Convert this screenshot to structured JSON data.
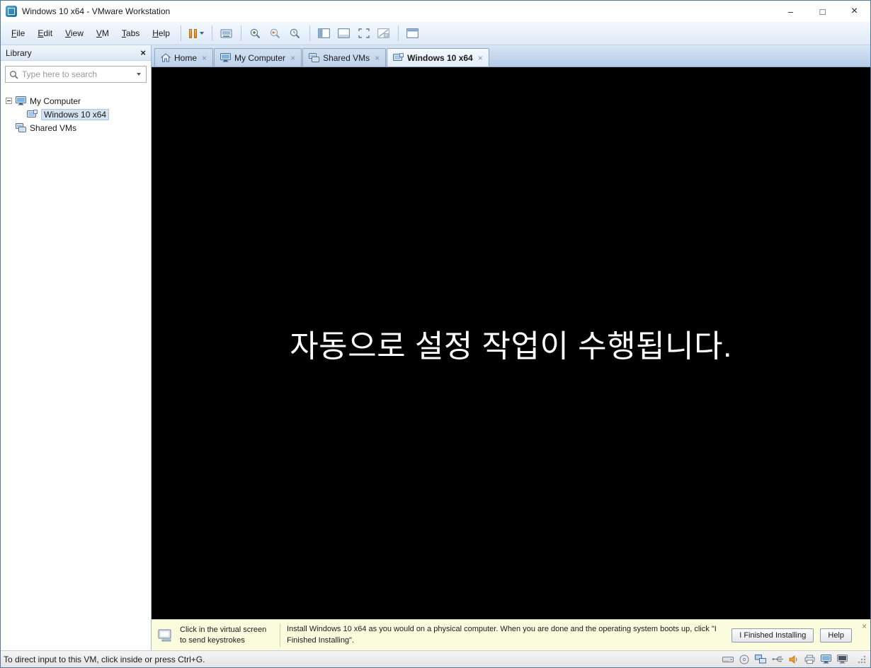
{
  "window": {
    "title": "Windows 10 x64 - VMware Workstation",
    "controls": {
      "minimize": "–",
      "maximize": "□",
      "close": "×"
    }
  },
  "glyphs": {
    "close": "×"
  },
  "menubar": {
    "items": [
      "File",
      "Edit",
      "View",
      "VM",
      "Tabs",
      "Help"
    ]
  },
  "toolbar": {
    "buttons": [
      "pause",
      "power-dropdown",
      "send-ctrl-alt-del",
      "take-snapshot",
      "revert-snapshot",
      "snapshot-manager",
      "show-library",
      "summary-view",
      "fullscreen",
      "unity-mode",
      "console-view"
    ],
    "pause_color": "#e8972e"
  },
  "library": {
    "title": "Library",
    "search_placeholder": "Type here to search",
    "tree": {
      "my_computer": "My Computer",
      "windows_vm": "Windows 10 x64",
      "shared_vms": "Shared VMs"
    }
  },
  "tabs": [
    {
      "label": "Home"
    },
    {
      "label": "My Computer"
    },
    {
      "label": "Shared VMs"
    },
    {
      "label": "Windows 10 x64",
      "active": true
    }
  ],
  "vm_screen": {
    "message": "자동으로 설정 작업이 수행됩니다.",
    "background": "#000000",
    "text_color": "#ffffff"
  },
  "notification": {
    "hint": "Click in the virtual screen to send keystrokes",
    "message": "Install Windows 10 x64 as you would on a physical computer. When you are done and the operating system boots up, click \"I Finished Installing\".",
    "finish_button": "I Finished Installing",
    "help_button": "Help",
    "background": "#fbfbdd"
  },
  "statusbar": {
    "message": "To direct input to this VM, click inside or press Ctrl+G.",
    "device_icons": [
      "hard-disk",
      "cd-dvd",
      "network-adapter",
      "usb-controller",
      "sound-card",
      "printer",
      "display",
      "console"
    ]
  },
  "colors": {
    "tabbar_blue": "#bcd2ea",
    "toolbar_blue": "#e8f0f9",
    "selection_blue": "#d5e2f0"
  }
}
